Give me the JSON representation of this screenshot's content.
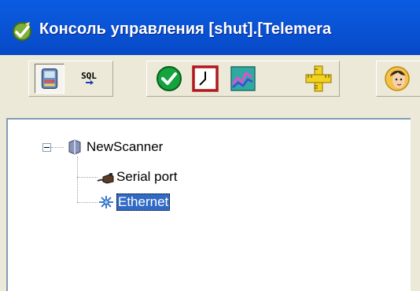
{
  "window": {
    "title": "Консоль управления [shut].[Telemera",
    "title_bar_color": "#0A56D9"
  },
  "toolbar": {
    "buttons": [
      {
        "name": "device-icon",
        "pressed": true
      },
      {
        "name": "sql-icon",
        "label": "SQL"
      },
      {
        "name": "check-icon"
      },
      {
        "name": "clock-icon"
      },
      {
        "name": "chart-icon"
      },
      {
        "name": "ruler-icon"
      },
      {
        "name": "user-avatar-icon"
      }
    ]
  },
  "tree": {
    "root": {
      "label": "NewScanner",
      "expanded": true,
      "expander_symbol": "−"
    },
    "children": [
      {
        "label": "Serial port",
        "icon": "serial-port-icon",
        "selected": false
      },
      {
        "label": "Ethernet",
        "icon": "ethernet-icon",
        "selected": true
      }
    ],
    "selection_color": "#316AC5"
  }
}
